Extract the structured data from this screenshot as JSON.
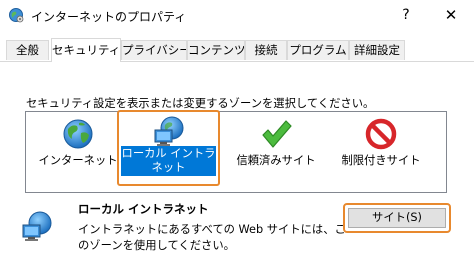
{
  "window": {
    "title": "インターネットのプロパティ",
    "help_label": "?",
    "close_label": "✕"
  },
  "tabs": [
    {
      "label": "全般"
    },
    {
      "label": "セキュリティ"
    },
    {
      "label": "プライバシー"
    },
    {
      "label": "コンテンツ"
    },
    {
      "label": "接続"
    },
    {
      "label": "プログラム"
    },
    {
      "label": "詳細設定"
    }
  ],
  "active_tab": "セキュリティ",
  "security": {
    "instruction": "セキュリティ設定を表示または変更するゾーンを選択してください。",
    "zones": [
      {
        "label": "インターネット",
        "icon": "globe-icon"
      },
      {
        "label": "ローカル イントラネット",
        "icon": "local-intranet-icon",
        "selected": true
      },
      {
        "label": "信頼済みサイト",
        "icon": "green-check-icon"
      },
      {
        "label": "制限付きサイト",
        "icon": "no-entry-icon"
      }
    ],
    "selected_zone": {
      "title": "ローカル イントラネット",
      "description": "イントラネットにあるすべての Web サイトには、このゾーンを使用してください。"
    },
    "sites_button": "サイト(S)"
  },
  "colors": {
    "highlight_outline": "#e8892e",
    "selection_bg": "#0078d7"
  }
}
